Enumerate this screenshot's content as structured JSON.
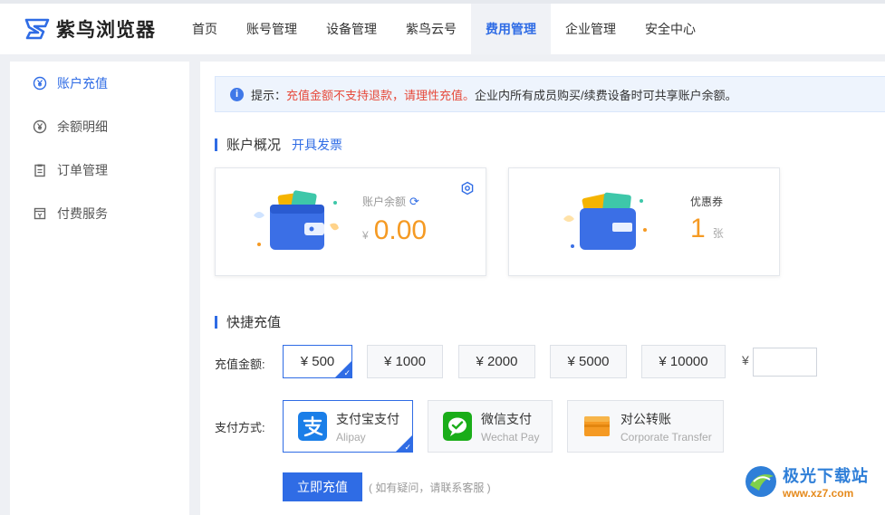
{
  "app": {
    "name": "紫鸟浏览器"
  },
  "nav": {
    "items": [
      {
        "label": "首页",
        "active": false
      },
      {
        "label": "账号管理",
        "active": false
      },
      {
        "label": "设备管理",
        "active": false
      },
      {
        "label": "紫鸟云号",
        "active": false
      },
      {
        "label": "费用管理",
        "active": true
      },
      {
        "label": "企业管理",
        "active": false
      },
      {
        "label": "安全中心",
        "active": false
      }
    ]
  },
  "sidebar": {
    "items": [
      {
        "label": "账户充值",
        "icon": "yen-circle-icon",
        "active": true
      },
      {
        "label": "余额明细",
        "icon": "balance-icon",
        "active": false
      },
      {
        "label": "订单管理",
        "icon": "clipboard-icon",
        "active": false
      },
      {
        "label": "付费服务",
        "icon": "service-icon",
        "active": false
      }
    ]
  },
  "notice": {
    "prefix": "提示：",
    "warning": "充值金额不支持退款，请理性充值。",
    "text": "企业内所有成员购买/续费设备时可共享账户余额。"
  },
  "account": {
    "title": "账户概况",
    "invoice_link": "开具发票",
    "balance_label": "账户余额",
    "currency": "¥",
    "balance": "0.00",
    "coupon_label": "优惠券",
    "coupon_count": "1",
    "coupon_unit": "张"
  },
  "recharge": {
    "title": "快捷充值",
    "amount_label": "充值金额:",
    "amounts": [
      "¥ 500",
      "¥ 1000",
      "¥ 2000",
      "¥ 5000",
      "¥ 10000"
    ],
    "selected_amount": "¥ 500",
    "custom_currency": "¥",
    "custom_value": "",
    "pay_label": "支付方式:",
    "methods": [
      {
        "name": "支付宝支付",
        "en": "Alipay",
        "icon": "alipay-icon",
        "selected": true
      },
      {
        "name": "微信支付",
        "en": "Wechat Pay",
        "icon": "wechat-icon",
        "selected": false
      },
      {
        "name": "对公转账",
        "en": "Corporate Transfer",
        "icon": "wallet-icon",
        "selected": false
      }
    ],
    "submit": "立即充值",
    "hint": "( 如有疑问，请联系客服 )"
  },
  "watermark": {
    "brand": "极光下载站",
    "url": "www.xz7.com"
  },
  "colors": {
    "accent": "#2f6ce5",
    "warning": "#e64a3b",
    "amount": "#f59a23"
  }
}
